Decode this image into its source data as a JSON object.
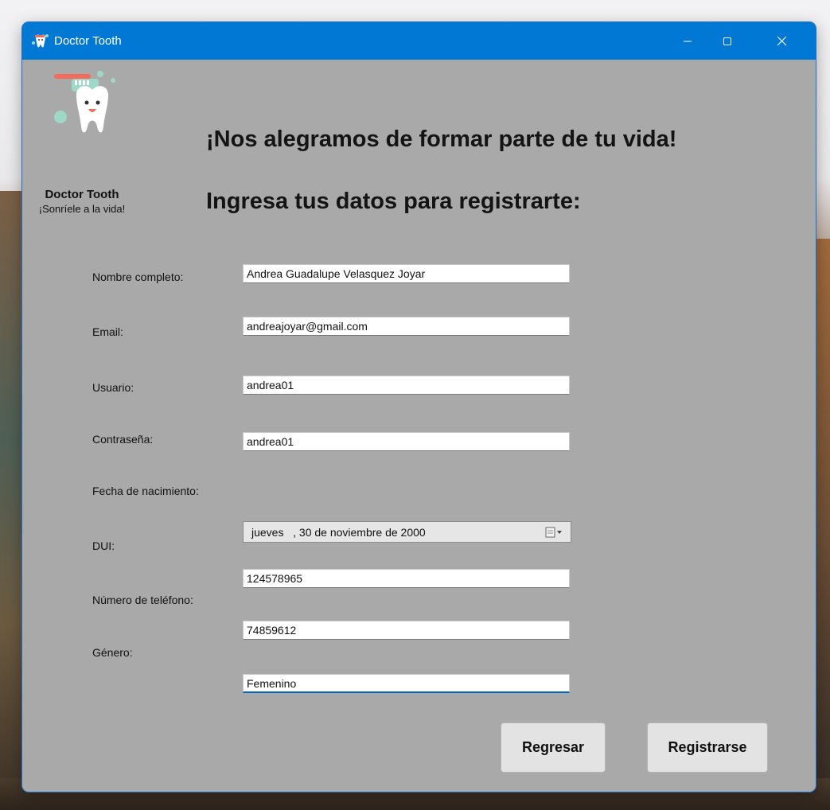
{
  "window": {
    "title": "Doctor Tooth"
  },
  "brand": {
    "name": "Doctor Tooth",
    "tagline": "¡Sonríele a la vida!"
  },
  "headings": {
    "welcome": "¡Nos alegramos de formar parte de tu vida!",
    "instruction": "Ingresa tus datos para registrarte:"
  },
  "form": {
    "full_name": {
      "label": "Nombre completo:",
      "value": "Andrea Guadalupe Velasquez Joyar"
    },
    "email": {
      "label": "Email:",
      "value": "andreajoyar@gmail.com"
    },
    "username": {
      "label": "Usuario:",
      "value": "andrea01"
    },
    "password": {
      "label": "Contraseña:",
      "value": "andrea01"
    },
    "birth_date": {
      "label": "Fecha de nacimiento:",
      "value": "jueves   , 30 de noviembre de 2000"
    },
    "dui": {
      "label": "DUI:",
      "value": "124578965"
    },
    "phone": {
      "label": "Número de teléfono:",
      "value": "74859612"
    },
    "gender": {
      "label": "Género:",
      "value": "Femenino"
    }
  },
  "buttons": {
    "back": "Regresar",
    "register": "Registrarse"
  },
  "colors": {
    "titlebar": "#0078d4",
    "window_bg": "#a9a9a9",
    "accent": "#0067c0"
  },
  "icons": [
    "app-tooth-icon",
    "minimize-icon",
    "maximize-icon",
    "close-icon",
    "calendar-dropdown-icon"
  ]
}
